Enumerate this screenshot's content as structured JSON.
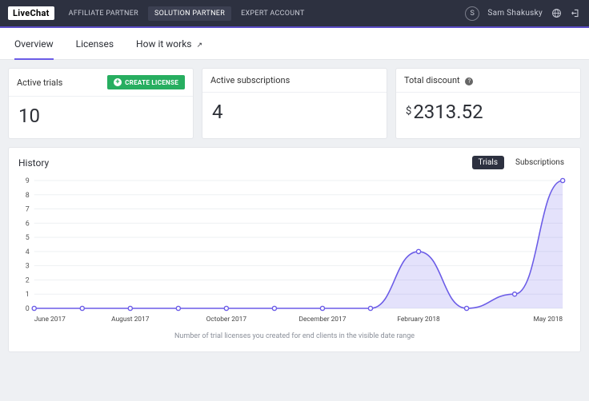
{
  "header": {
    "logo_text": "LiveChat",
    "nav": [
      "AFFILIATE PARTNER",
      "SOLUTION PARTNER",
      "EXPERT ACCOUNT"
    ],
    "nav_active_index": 1,
    "user_initial": "S",
    "user_name": "Sam Shakusky"
  },
  "subnav": {
    "tabs": [
      "Overview",
      "Licenses",
      "How it works"
    ],
    "active_index": 0,
    "external_marker": "↗"
  },
  "cards": {
    "trials": {
      "title": "Active trials",
      "value": "10",
      "button_label": "CREATE LICENSE"
    },
    "subs": {
      "title": "Active subscriptions",
      "value": "4"
    },
    "discount": {
      "title": "Total discount",
      "currency": "$",
      "value": "2313.52"
    }
  },
  "history": {
    "title": "History",
    "toggle": {
      "options": [
        "Trials",
        "Subscriptions"
      ],
      "active_index": 0
    },
    "caption": "Number of trial licenses you created for end clients in the visible date range"
  },
  "chart_data": {
    "type": "line",
    "ylim": [
      0,
      9
    ],
    "yticks": [
      0,
      1,
      2,
      3,
      4,
      5,
      6,
      7,
      8,
      9
    ],
    "x_tick_labels": [
      "June 2017",
      "August 2017",
      "October 2017",
      "December 2017",
      "February 2018",
      "May 2018"
    ],
    "categories": [
      "Jun 2017",
      "Jul 2017",
      "Aug 2017",
      "Sep 2017",
      "Oct 2017",
      "Nov 2017",
      "Dec 2017",
      "Jan 2018",
      "Feb 2018",
      "Mar 2018",
      "Apr 2018",
      "May 2018"
    ],
    "values": [
      0,
      0,
      0,
      0,
      0,
      0,
      0,
      0,
      4,
      0,
      1,
      9
    ]
  }
}
